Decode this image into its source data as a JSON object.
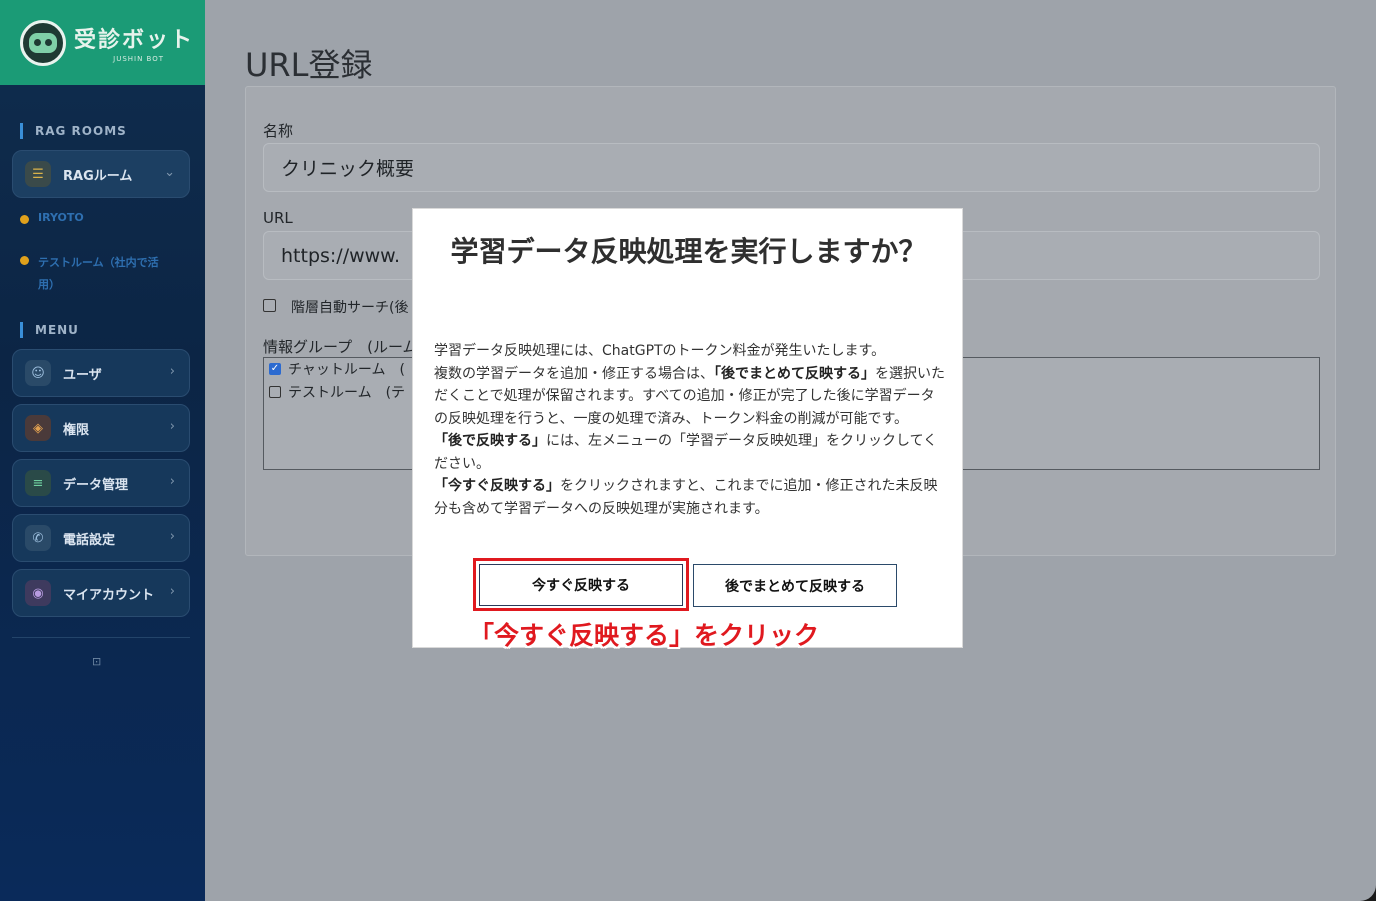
{
  "brand": {
    "name": "受診ボット",
    "sub": "JUSHIN BOT",
    "logo_icon": "robot-logo-icon"
  },
  "sidebar": {
    "rag_section_title": "RAG ROOMS",
    "rag_button": {
      "label": "RAGルーム",
      "icon": "database-icon"
    },
    "rooms": [
      {
        "label": "IRYOTO"
      },
      {
        "label": "テストルーム（社内で活用）"
      }
    ],
    "menu_section_title": "MENU",
    "menu_items": [
      {
        "label": "ユーザ",
        "icon": "user-icon"
      },
      {
        "label": "権限",
        "icon": "shield-icon"
      },
      {
        "label": "データ管理",
        "icon": "database-icon"
      },
      {
        "label": "電話設定",
        "icon": "phone-icon"
      },
      {
        "label": "マイアカウント",
        "icon": "account-icon"
      }
    ]
  },
  "page": {
    "title": "URL登録",
    "name_label": "名称",
    "name_value": "クリニック概要",
    "url_label": "URL",
    "url_value": "https://www.",
    "auto_search_label": "階層自動サーチ(後",
    "group_label": "情報グループ　(ルーム",
    "groups": [
      {
        "label": "チャットルーム　(",
        "checked": true
      },
      {
        "label": "テストルーム　(テ",
        "checked": false
      }
    ]
  },
  "modal": {
    "title": "学習データ反映処理を実行しますか？",
    "body_line1": "学習データ反映処理には、ChatGPTのトークン料金が発生いたします。",
    "body_p2_a": "複数の学習データを追加・修正する場合は、",
    "body_p2_bold": "「後でまとめて反映する」",
    "body_p2_b": "を選択いただくことで処理が保留されます。すべての追加・修正が完了した後に学習データの反映処理を行うと、一度の処理で済み、トークン料金の削減が可能です。",
    "body_p3_bold": "「後で反映する」",
    "body_p3_b": "には、左メニューの「学習データ反映処理」をクリックしてください。",
    "body_p4_bold": "「今すぐ反映する」",
    "body_p4_b": "をクリックされますと、これまでに追加・修正された未反映分も含めて学習データへの反映処理が実施されます。",
    "btn_now": "今すぐ反映する",
    "btn_later": "後でまとめて反映する",
    "callout": "「今すぐ反映する」をクリック",
    "highlight_color": "#e0191f"
  }
}
